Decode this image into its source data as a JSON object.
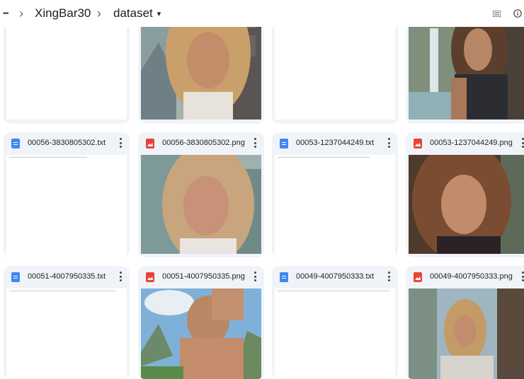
{
  "topbar": {
    "more_label": "•••",
    "crumbs": [
      "XingBar30",
      "dataset"
    ],
    "chevron": "›",
    "dropdown_caret": "▾"
  },
  "files": [
    {
      "name": "00056-3830805302.txt",
      "type": "text"
    },
    {
      "name": "00056-3830805302.png",
      "type": "image"
    },
    {
      "name": "00053-1237044249.txt",
      "type": "text"
    },
    {
      "name": "00053-1237044249.png",
      "type": "image"
    },
    {
      "name": "00051-4007950335.txt",
      "type": "text"
    },
    {
      "name": "00051-4007950335.png",
      "type": "image"
    },
    {
      "name": "00049-4007950333.txt",
      "type": "text"
    },
    {
      "name": "00049-4007950333.png",
      "type": "image"
    }
  ],
  "icons": {
    "more": "more-horiz-icon",
    "list_view": "list-view-icon",
    "info": "info-icon",
    "text_file": "text-file-icon",
    "image_file": "image-file-icon",
    "kebab": "more-vert-icon"
  },
  "colors": {
    "card_bg": "#f0f4f9",
    "text_icon": "#4285f4",
    "image_icon": "#ea4335"
  }
}
